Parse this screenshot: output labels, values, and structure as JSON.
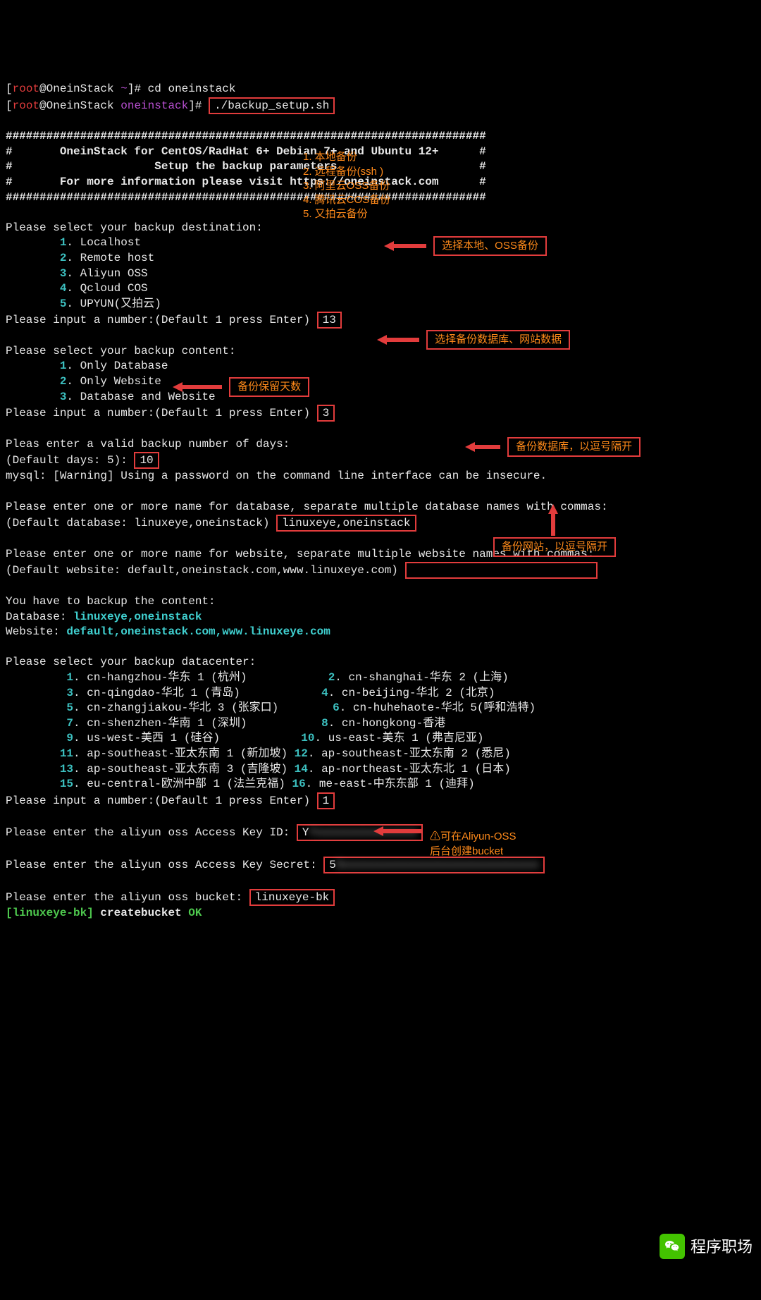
{
  "prompt1_user": "root",
  "prompt1_host": "@OneinStack ",
  "prompt1_tilde": "~",
  "prompt1_end": "]# ",
  "cmd1": "cd oneinstack",
  "prompt2_user": "root",
  "prompt2_host": "@OneinStack ",
  "prompt2_dir": "oneinstack",
  "prompt2_end": "]# ",
  "cmd2": "./backup_setup.sh",
  "hashline": "#######################################################################",
  "banner1": "#       OneinStack for CentOS/RadHat 6+ Debian 7+ and Ubuntu 12+      #",
  "banner2": "#                     Setup the backup parameters                     #",
  "banner3": "#       For more information please visit https://oneinstack.com      #",
  "dest_title": "Please select your backup destination:",
  "dest_opts": [
    {
      "n": "1",
      "t": ". Localhost"
    },
    {
      "n": "2",
      "t": ". Remote host"
    },
    {
      "n": "3",
      "t": ". Aliyun OSS"
    },
    {
      "n": "4",
      "t": ". Qcloud COS"
    },
    {
      "n": "5",
      "t": ". UPYUN(又拍云)"
    }
  ],
  "input_prompt": "Please input a number:(Default 1 press Enter) ",
  "input1_val": "13",
  "content_title": "Please select your backup content:",
  "content_opts": [
    {
      "n": "1",
      "t": ". Only Database"
    },
    {
      "n": "2",
      "t": ". Only Website"
    },
    {
      "n": "3",
      "t": ". Database and Website"
    }
  ],
  "input2_val": "3",
  "days_prompt": "Pleas enter a valid backup number of days:",
  "days_default": "(Default days: 5): ",
  "days_val": "10",
  "mysql_warn": "mysql: [Warning] Using a password on the command line interface can be insecure.",
  "db_prompt": "Please enter one or more name for database, separate multiple database names with commas:",
  "db_default": "(Default database: linuxeye,oneinstack) ",
  "db_val": "linuxeye,oneinstack",
  "web_prompt": "Please enter one or more name for website, separate multiple website names with commas:",
  "web_default": "(Default website: default,oneinstack.com,www.linuxeye.com) ",
  "summary_title": "You have to backup the content:",
  "summary_db_lbl": "Database: ",
  "summary_db_val": "linuxeye,oneinstack",
  "summary_web_lbl": "Website: ",
  "summary_web_val": "default,oneinstack.com,www.linuxeye.com",
  "dc_title": "Please select your backup datacenter:",
  "dc": [
    {
      "n": "1",
      "t": ". cn-hangzhou-华东 1 (杭州)"
    },
    {
      "n": "2",
      "t": ". cn-shanghai-华东 2 (上海)"
    },
    {
      "n": "3",
      "t": ". cn-qingdao-华北 1 (青岛)"
    },
    {
      "n": "4",
      "t": ". cn-beijing-华北 2 (北京)"
    },
    {
      "n": "5",
      "t": ". cn-zhangjiakou-华北 3 (张家口)"
    },
    {
      "n": "6",
      "t": ". cn-huhehaote-华北 5(呼和浩特)"
    },
    {
      "n": "7",
      "t": ". cn-shenzhen-华南 1 (深圳)"
    },
    {
      "n": "8",
      "t": ". cn-hongkong-香港"
    },
    {
      "n": "9",
      "t": ". us-west-美西 1 (硅谷)"
    },
    {
      "n": "10",
      "t": ". us-east-美东 1 (弗吉尼亚)"
    },
    {
      "n": "11",
      "t": ". ap-southeast-亚太东南 1 (新加坡)"
    },
    {
      "n": "12",
      "t": ". ap-southeast-亚太东南 2 (悉尼)"
    },
    {
      "n": "13",
      "t": ". ap-southeast-亚太东南 3 (吉隆坡)"
    },
    {
      "n": "14",
      "t": ". ap-northeast-亚太东北 1 (日本)"
    },
    {
      "n": "15",
      "t": ". eu-central-欧洲中部 1 (法兰克福)"
    },
    {
      "n": "16",
      "t": ". me-east-中东东部 1 (迪拜)"
    }
  ],
  "input3_val": "1",
  "akid_prompt": "Please enter the aliyun oss Access Key ID: ",
  "akid_val": "Yxxxxxxxxxxxxxxx",
  "aksec_prompt": "Please enter the aliyun oss Access Key Secret: ",
  "aksec_val": "5xxxxxxxxxxxxxxxxxxxxxxxxxxxxx",
  "bucket_prompt": "Please enter the aliyun oss bucket: ",
  "bucket_val": "linuxeye-bk",
  "result_brkt": "[linuxeye-bk]",
  "result_action": " createbucket ",
  "result_status": "OK",
  "anno_dest": [
    "1. 本地备份",
    "2. 远程备份(ssh )",
    "3. 阿里云OSS备份",
    "4. 腾讯云COS备份",
    "5. 又拍云备份"
  ],
  "anno1": "选择本地、OSS备份",
  "anno2": "选择备份数据库、网站数据",
  "anno3": "备份保留天数",
  "anno4": "备份数据库，以逗号隔开",
  "anno5": "备份网站，以逗号隔开",
  "anno6a": "⚠可在Aliyun-OSS",
  "anno6b": "后台创建bucket",
  "brand": "程序职场"
}
